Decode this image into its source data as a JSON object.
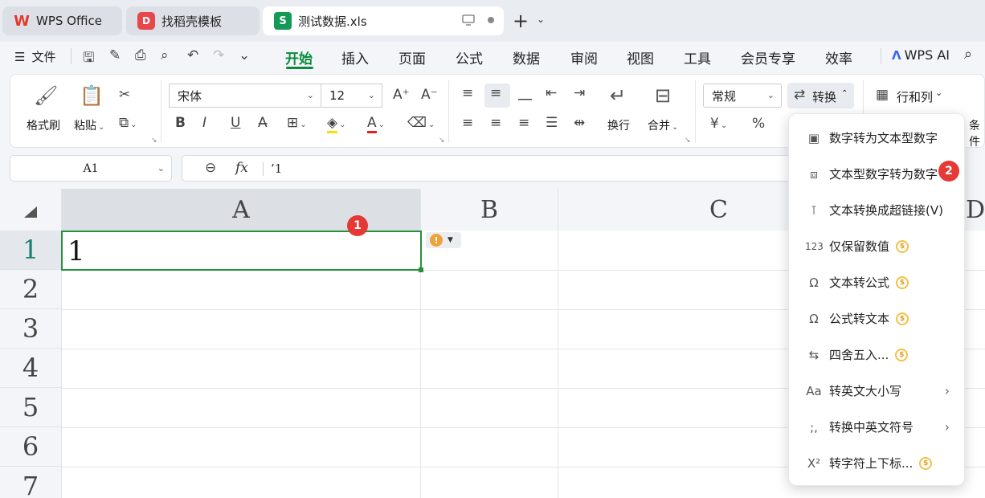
{
  "tabs": [
    {
      "label": "WPS Office",
      "icon": "wps-logo-icon",
      "logo_glyph": "W"
    },
    {
      "label": "找稻壳模板",
      "icon": "docer-logo-icon",
      "logo_glyph": "D"
    },
    {
      "label": "测试数据.xls",
      "icon": "spreadsheet-logo-icon",
      "logo_glyph": "S"
    }
  ],
  "menubar": {
    "file_label": "文件",
    "items": [
      "开始",
      "插入",
      "页面",
      "公式",
      "数据",
      "审阅",
      "视图",
      "工具",
      "会员专享",
      "效率"
    ],
    "active": "开始",
    "ai_label": "WPS AI"
  },
  "ribbon": {
    "format_painter": "格式刷",
    "paste": "粘贴",
    "font_name": "宋体",
    "font_size": "12",
    "wrap": "换行",
    "merge": "合并",
    "number_format": "常规",
    "convert": "转换",
    "rows_cols": "行和列",
    "cond_partial": "条件",
    "currency_glyph": "¥",
    "percent_glyph": "%"
  },
  "formula_bar": {
    "cell_ref": "A1",
    "fx": "fx",
    "value": "’1"
  },
  "sheet": {
    "columns": [
      "A",
      "B",
      "C",
      "D"
    ],
    "rows": [
      "1",
      "2",
      "3",
      "4",
      "5",
      "6",
      "7"
    ],
    "cell_a1": "1",
    "selected_cell": "A1"
  },
  "badges": {
    "one": "1",
    "two": "2"
  },
  "dropdown": {
    "items": [
      {
        "label": "数字转为文本型数字",
        "icon": "num-to-text-icon",
        "premium": false,
        "submenu": false
      },
      {
        "label": "文本型数字转为数字",
        "icon": "text-to-num-icon",
        "premium": false,
        "submenu": false
      },
      {
        "label": "文本转换成超链接(V)",
        "icon": "text-to-link-icon",
        "premium": false,
        "submenu": false
      },
      {
        "label": "仅保留数值",
        "icon": "keep-values-icon",
        "premium": true,
        "submenu": false
      },
      {
        "label": "文本转公式",
        "icon": "text-to-formula-icon",
        "premium": true,
        "submenu": false
      },
      {
        "label": "公式转文本",
        "icon": "formula-to-text-icon",
        "premium": true,
        "submenu": false
      },
      {
        "label": "四舍五入...",
        "icon": "round-icon",
        "premium": true,
        "submenu": false
      },
      {
        "label": "转英文大小写",
        "icon": "case-icon",
        "premium": false,
        "submenu": true
      },
      {
        "label": "转换中英文符号",
        "icon": "punctuation-icon",
        "premium": false,
        "submenu": true
      },
      {
        "label": "转字符上下标...",
        "icon": "superscript-icon",
        "premium": true,
        "submenu": false
      }
    ]
  },
  "colors": {
    "accent": "#0b8a3d",
    "selection_border": "#2a8f3c",
    "badge": "#e53935"
  }
}
